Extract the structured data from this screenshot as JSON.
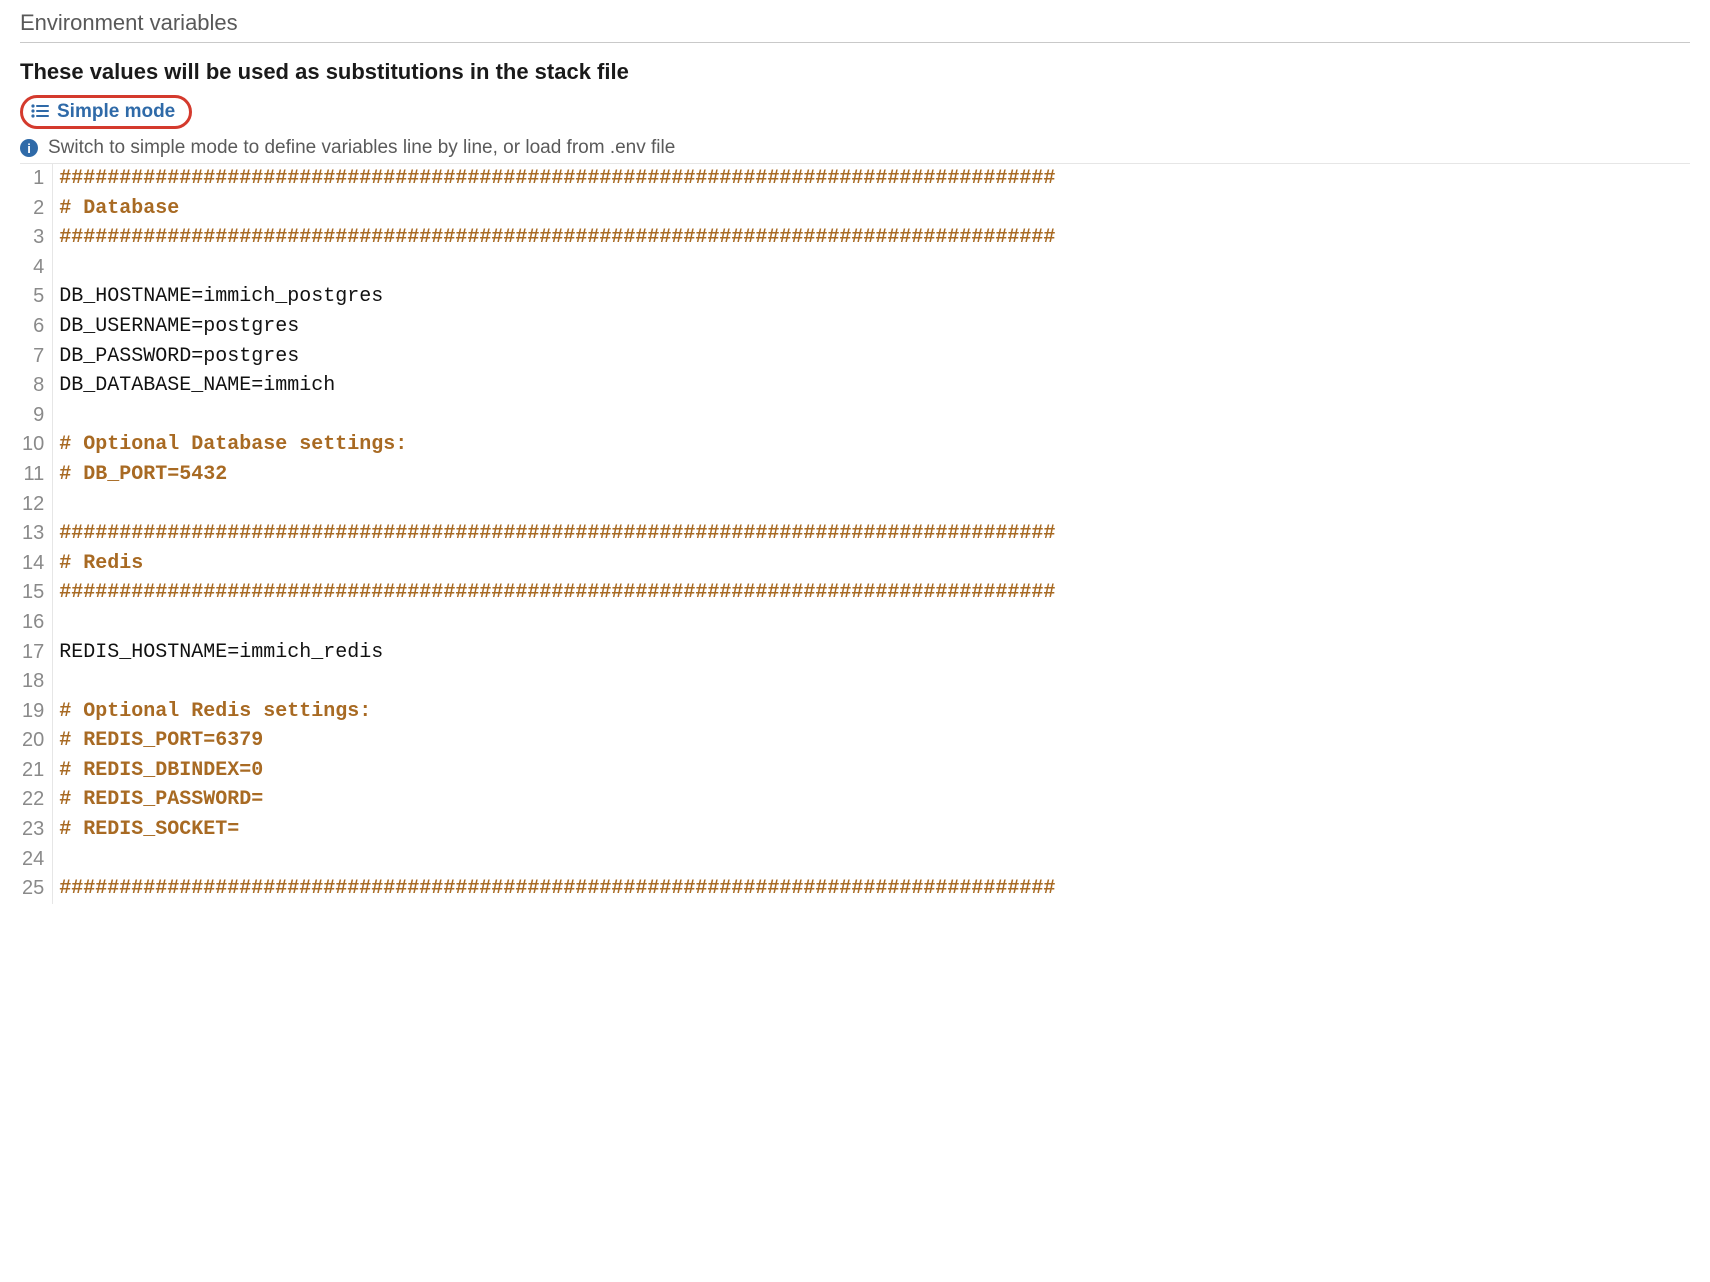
{
  "header": {
    "title": "Environment variables",
    "subtitle": "These values will be used as substitutions in the stack file"
  },
  "modeButton": {
    "label": "Simple mode"
  },
  "infoBanner": {
    "text": "Switch to simple mode to define variables line by line, or load from .env file"
  },
  "editor": {
    "lines": [
      {
        "n": 1,
        "type": "comment",
        "text": "###################################################################################"
      },
      {
        "n": 2,
        "type": "comment",
        "text": "# Database"
      },
      {
        "n": 3,
        "type": "comment",
        "text": "###################################################################################"
      },
      {
        "n": 4,
        "type": "plain",
        "text": ""
      },
      {
        "n": 5,
        "type": "plain",
        "text": "DB_HOSTNAME=immich_postgres"
      },
      {
        "n": 6,
        "type": "plain",
        "text": "DB_USERNAME=postgres"
      },
      {
        "n": 7,
        "type": "plain",
        "text": "DB_PASSWORD=postgres"
      },
      {
        "n": 8,
        "type": "plain",
        "text": "DB_DATABASE_NAME=immich"
      },
      {
        "n": 9,
        "type": "plain",
        "text": ""
      },
      {
        "n": 10,
        "type": "comment",
        "text": "# Optional Database settings:"
      },
      {
        "n": 11,
        "type": "comment",
        "text": "# DB_PORT=5432"
      },
      {
        "n": 12,
        "type": "plain",
        "text": ""
      },
      {
        "n": 13,
        "type": "comment",
        "text": "###################################################################################"
      },
      {
        "n": 14,
        "type": "comment",
        "text": "# Redis"
      },
      {
        "n": 15,
        "type": "comment",
        "text": "###################################################################################"
      },
      {
        "n": 16,
        "type": "plain",
        "text": ""
      },
      {
        "n": 17,
        "type": "plain",
        "text": "REDIS_HOSTNAME=immich_redis"
      },
      {
        "n": 18,
        "type": "plain",
        "text": ""
      },
      {
        "n": 19,
        "type": "comment",
        "text": "# Optional Redis settings:"
      },
      {
        "n": 20,
        "type": "comment",
        "text": "# REDIS_PORT=6379"
      },
      {
        "n": 21,
        "type": "comment",
        "text": "# REDIS_DBINDEX=0"
      },
      {
        "n": 22,
        "type": "comment",
        "text": "# REDIS_PASSWORD="
      },
      {
        "n": 23,
        "type": "comment",
        "text": "# REDIS_SOCKET="
      },
      {
        "n": 24,
        "type": "plain",
        "text": ""
      },
      {
        "n": 25,
        "type": "comment",
        "text": "###################################################################################"
      }
    ]
  }
}
